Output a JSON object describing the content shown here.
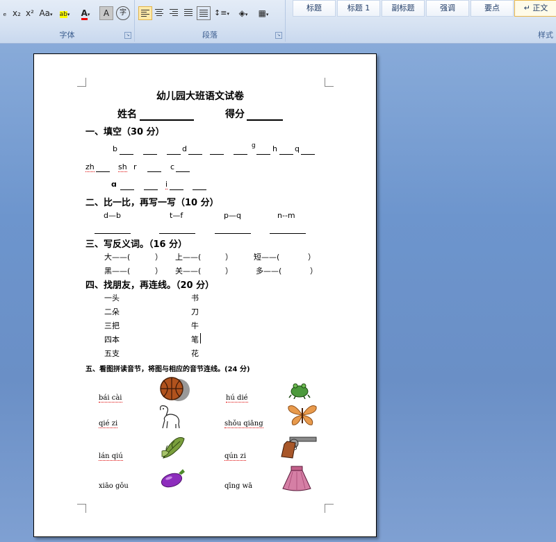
{
  "ribbon": {
    "font_group": {
      "label": "字体",
      "buttons": [
        "ₑ",
        "x₂",
        "x²",
        "Aa",
        "ab",
        "A",
        "A",
        "字"
      ]
    },
    "para_group": {
      "label": "段落"
    },
    "styles": {
      "label": "样式",
      "items": [
        "标题",
        "标题 1",
        "副标题",
        "强调",
        "要点",
        "↵ 正文"
      ]
    }
  },
  "doc": {
    "title": "幼儿园大班语文试卷",
    "name_label": "姓名",
    "score_label": "得分",
    "s1": {
      "heading": "一、填空（30 分）",
      "row1": [
        "b",
        "d",
        "g",
        "h",
        "q"
      ],
      "row2": [
        "zh",
        "sh",
        "r",
        "c"
      ],
      "row3": [
        "ɑ",
        "i"
      ]
    },
    "s2": {
      "heading": "二、比一比，再写一写（10 分）",
      "pairs": [
        "d—b",
        "t—f",
        "p—q",
        "n--m"
      ]
    },
    "s3": {
      "heading": "三、写反义词。（16 分）",
      "row1": [
        "大——(",
        "）",
        "上——(",
        "）",
        "短——(",
        "）"
      ],
      "row2": [
        "黑——(",
        "）",
        "关——(",
        "）",
        "多——(",
        "）"
      ]
    },
    "s4": {
      "heading": "四、找朋友，再连线。（20 分）",
      "left": [
        "一头",
        "二朵",
        "三把",
        "四本",
        "五支"
      ],
      "right": [
        "书",
        "刀",
        "牛",
        "笔",
        "花"
      ]
    },
    "s5": {
      "heading": "五、看图拼读音节，将图与相应的音节连线。(24 分)",
      "left": [
        "bái cài",
        "qié zi",
        "lán qiú",
        "xiāo gǒu"
      ],
      "right": [
        "hú dié",
        "shǒu qiāng",
        "qún zi",
        "qīng wā"
      ],
      "pictures_left": [
        "basketball",
        "dog",
        "cabbage",
        "eggplant"
      ],
      "pictures_right": [
        "frog",
        "butterfly",
        "pistol",
        "skirt"
      ]
    }
  }
}
